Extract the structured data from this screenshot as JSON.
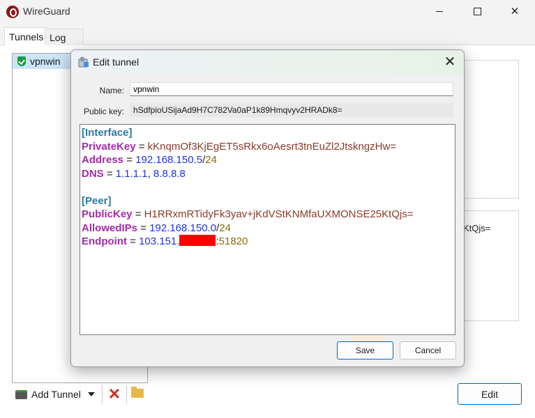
{
  "app": {
    "title": "WireGuard"
  },
  "tabs": [
    {
      "label": "Tunnels"
    },
    {
      "label": "Log"
    }
  ],
  "tunnels": [
    {
      "name": "vpnwin"
    }
  ],
  "background_panel": {
    "partial_text": "KtQjs="
  },
  "toolbar": {
    "add_tunnel_label": "Add Tunnel",
    "edit_label": "Edit"
  },
  "dialog": {
    "title": "Edit tunnel",
    "name_label": "Name:",
    "name_value": "vpnwin",
    "pubkey_label": "Public key:",
    "pubkey_value": "hSdfpioUSijaAd9H7C782Va0aP1k89Hmqvyv2HRADk8=",
    "config": {
      "interface_header": "[Interface]",
      "private_key_name": "PrivateKey",
      "private_key_value": "kKnqmOf3KjEgET5sRkx6oAesrt3tnEuZl2JtskngzHw=",
      "address_name": "Address",
      "address_ip": "192.168.150.5",
      "address_prefix": "24",
      "dns_name": "DNS",
      "dns_1": "1.1.1.1",
      "dns_2": "8.8.8.8",
      "peer_header": "[Peer]",
      "public_key_name": "PublicKey",
      "public_key_value": "H1RRxmRTidyFk3yav+jKdVStKNMfaUXMONSE25KtQjs=",
      "allowed_ips_name": "AllowedIPs",
      "allowed_ips_ip": "192.168.150.0",
      "allowed_ips_prefix": "24",
      "endpoint_name": "Endpoint",
      "endpoint_ip_visible": "103.151.",
      "endpoint_port": "51820"
    },
    "save_label": "Save",
    "cancel_label": "Cancel"
  },
  "colors": {
    "accent": "#0067c0",
    "redaction": "#ff0000",
    "selection": "#cce4f7"
  }
}
